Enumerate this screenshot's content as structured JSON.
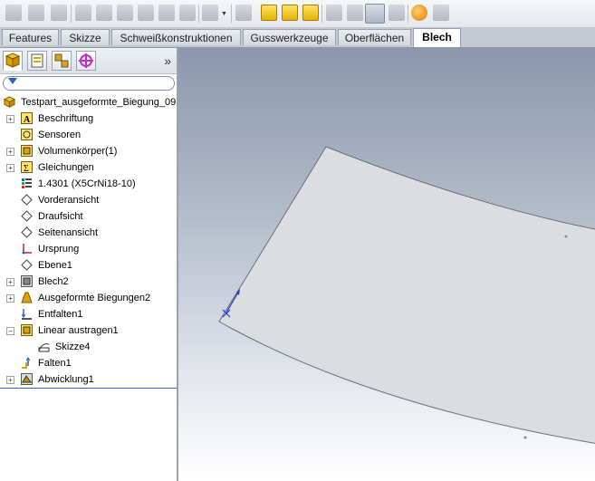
{
  "tabs": [
    "Features",
    "Skizze",
    "Schweißkonstruktionen",
    "Gusswerkzeuge",
    "Oberflächen",
    "Blech"
  ],
  "tree": {
    "root": "Testpart_ausgeformte_Biegung_09",
    "items": [
      {
        "label": "Beschriftung",
        "icon": "annotation-icon",
        "expander": "+"
      },
      {
        "label": "Sensoren",
        "icon": "sensor-icon",
        "expander": ""
      },
      {
        "label": "Volumenkörper(1)",
        "icon": "solid-body-icon",
        "expander": "+"
      },
      {
        "label": "Gleichungen",
        "icon": "equation-icon",
        "expander": "+"
      },
      {
        "label": "1.4301 (X5CrNi18-10)",
        "icon": "material-icon",
        "expander": ""
      },
      {
        "label": "Vorderansicht",
        "icon": "plane-icon",
        "expander": ""
      },
      {
        "label": "Draufsicht",
        "icon": "plane-icon",
        "expander": ""
      },
      {
        "label": "Seitenansicht",
        "icon": "plane-icon",
        "expander": ""
      },
      {
        "label": "Ursprung",
        "icon": "origin-icon",
        "expander": ""
      },
      {
        "label": "Ebene1",
        "icon": "plane-icon",
        "expander": ""
      },
      {
        "label": "Blech2",
        "icon": "sheet-metal-icon",
        "expander": "+"
      },
      {
        "label": "Ausgeformte Biegungen2",
        "icon": "lofted-bend-icon",
        "expander": "+"
      },
      {
        "label": "Entfalten1",
        "icon": "unfold-icon",
        "expander": ""
      },
      {
        "label": "Linear austragen1",
        "icon": "extrude-icon",
        "expander": "−"
      },
      {
        "label": "Skizze4",
        "icon": "sketch-icon",
        "expander": "",
        "indent": 1
      },
      {
        "label": "Falten1",
        "icon": "fold-icon",
        "expander": ""
      },
      {
        "label": "Abwicklung1",
        "icon": "flat-pattern-icon",
        "expander": "+"
      }
    ]
  },
  "colors": {
    "accent": "#3a66b0",
    "part_face": "#dcdde0"
  }
}
